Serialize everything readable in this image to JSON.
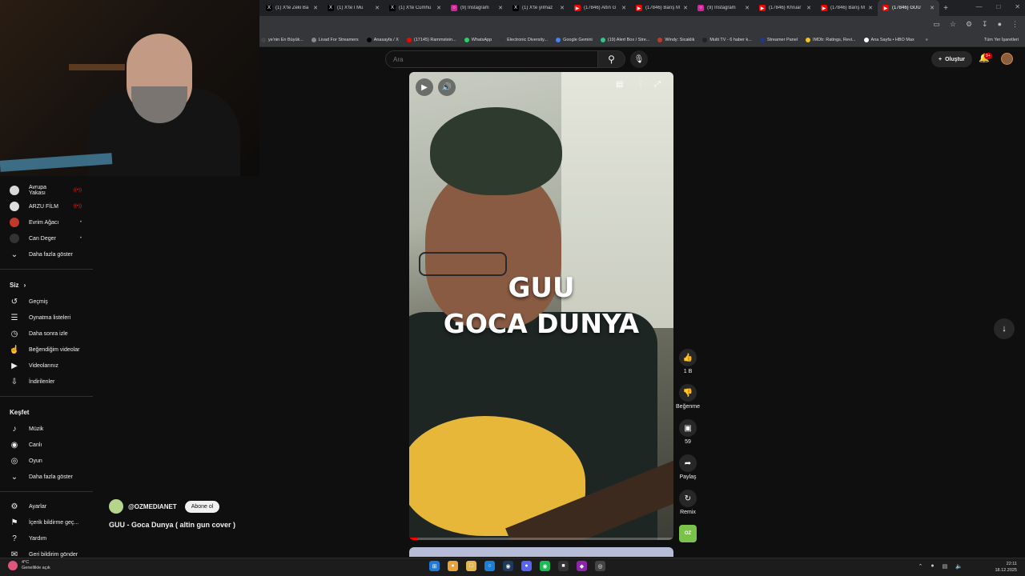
{
  "browser": {
    "tabs": [
      {
        "label": "(1) X'te Zeki Ba",
        "icon": "x-logo",
        "color": "#000000",
        "active": false
      },
      {
        "label": "(1) X'te İ Mu",
        "icon": "x-logo",
        "color": "#000000",
        "active": false
      },
      {
        "label": "(1) X'te Cumhu",
        "icon": "x-logo",
        "color": "#000000",
        "active": false
      },
      {
        "label": "(9) Instagram",
        "icon": "instagram-logo",
        "color": "#d6249f",
        "active": false
      },
      {
        "label": "(1) X'te yılmaz",
        "icon": "x-logo",
        "color": "#000000",
        "active": false
      },
      {
        "label": "(17846) Altın G",
        "icon": "youtube-logo",
        "color": "#ff0000",
        "active": false
      },
      {
        "label": "(17846) Barış M",
        "icon": "youtube-logo",
        "color": "#ff0000",
        "active": false
      },
      {
        "label": "(9) Instagram",
        "icon": "instagram-logo",
        "color": "#d6249f",
        "active": false
      },
      {
        "label": "(17846) Khruar",
        "icon": "youtube-logo",
        "color": "#ff0000",
        "active": false
      },
      {
        "label": "(17846) Barış M",
        "icon": "youtube-logo",
        "color": "#ff0000",
        "active": false
      },
      {
        "label": "(17846) GUU",
        "icon": "youtube-logo",
        "color": "#ff0000",
        "active": true
      }
    ],
    "new_tab": "+",
    "bookmarks": [
      {
        "label": "ye'nin En Büyük...",
        "color": "#444444"
      },
      {
        "label": "Livad For Streamers",
        "color": "#888888"
      },
      {
        "label": "Anasayfa / X",
        "color": "#000000"
      },
      {
        "label": "(17145) Rammstein...",
        "color": "#ff0000"
      },
      {
        "label": "WhatsApp",
        "color": "#25d366"
      },
      {
        "label": "Electronic Diversity...",
        "color": "#333333"
      },
      {
        "label": "Google Gemini",
        "color": "#4a7dff"
      },
      {
        "label": "(19) Alert Box / Stre...",
        "color": "#31c48d"
      },
      {
        "label": "Windy: Sicaklik",
        "color": "#c0392b"
      },
      {
        "label": "Multi TV - 6 haber k...",
        "color": "#222222"
      },
      {
        "label": "Streamer Panel",
        "color": "#1e3a8a"
      },
      {
        "label": "IMDb: Ratings, Revi...",
        "color": "#f5c518"
      },
      {
        "label": "Ana Sayfa • HBO Max",
        "color": "#ffffff"
      }
    ],
    "more_bookmarks": "»",
    "all_bookmarks": "Tüm Yer İşaretleri"
  },
  "header": {
    "search_placeholder": "Ara",
    "create_label": "Oluştur",
    "notif_badge": "9+"
  },
  "sidebar": {
    "subscriptions": [
      {
        "label": "Avrupa Yakası",
        "live": true,
        "color": "#d9d9d9"
      },
      {
        "label": "ARZU FİLM",
        "live": true,
        "color": "#e0e0e0"
      },
      {
        "label": "Evrim Ağacı",
        "live": false,
        "color": "#c0392b"
      },
      {
        "label": "Can Deger",
        "live": false,
        "color": "#333333"
      }
    ],
    "live_mark": "((•))",
    "dot_mark": "•",
    "show_more": "Daha fazla göster",
    "you_title": "Siz",
    "you_items": [
      {
        "label": "Geçmiş",
        "icon": "history-icon"
      },
      {
        "label": "Oynatma listeleri",
        "icon": "playlist-icon"
      },
      {
        "label": "Daha sonra izle",
        "icon": "clock-icon"
      },
      {
        "label": "Beğendiğim videolar",
        "icon": "like-icon"
      },
      {
        "label": "Videolarınız",
        "icon": "video-icon"
      },
      {
        "label": "İndirilenler",
        "icon": "download-icon"
      }
    ],
    "explore_title": "Keşfet",
    "explore_items": [
      {
        "label": "Müzik",
        "icon": "music-icon"
      },
      {
        "label": "Canlı",
        "icon": "live-icon"
      },
      {
        "label": "Oyun",
        "icon": "gamepad-icon"
      },
      {
        "label": "Daha fazla göster",
        "icon": "chevron-down-icon"
      }
    ],
    "footer_items": [
      {
        "label": "Ayarlar",
        "icon": "gear-icon"
      },
      {
        "label": "İçerik bildirme geç...",
        "icon": "flag-icon"
      },
      {
        "label": "Yardım",
        "icon": "help-icon"
      },
      {
        "label": "Geri bildirim gönder",
        "icon": "feedback-icon"
      }
    ]
  },
  "video": {
    "overlay_line1": "GUU",
    "overlay_line2": "GOCA DUNYA",
    "progress": 0.03,
    "channel": "@OZMEDIANET",
    "subscribe": "Abone ol",
    "title": "GUU - Goca Dunya ( altin gun cover )"
  },
  "actions": {
    "likes": "1 B",
    "dislike": "Beğenme",
    "comments": "59",
    "share": "Paylaş",
    "remix": "Remix",
    "channel_thumb": "OZ"
  },
  "taskbar": {
    "temp": "4°C",
    "weather": "Genellikle açık",
    "time": "22:11",
    "date": "18.12.2025"
  }
}
